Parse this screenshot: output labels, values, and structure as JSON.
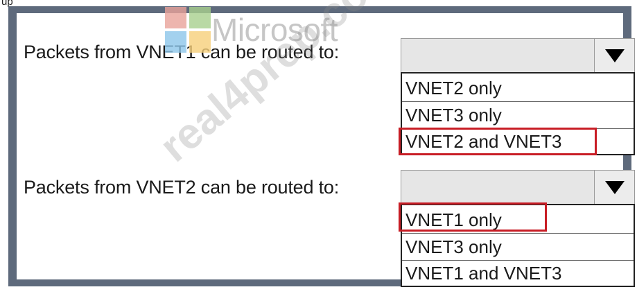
{
  "header": {
    "fragment": "up"
  },
  "questions": [
    {
      "label": "Packets from VNET1 can be routed to:",
      "selected_value": "",
      "options": [
        "VNET2 only",
        "VNET3 only",
        "VNET2 and VNET3"
      ],
      "highlighted_option": "VNET2 and VNET3"
    },
    {
      "label": "Packets from VNET2 can be routed to:",
      "selected_value": "",
      "options": [
        "VNET1 only",
        "VNET3 only",
        "VNET1 and VNET3"
      ],
      "highlighted_option": "VNET1 only"
    }
  ],
  "watermarks": {
    "brand": "Microsoft",
    "site": "real4prep.com"
  },
  "colors": {
    "highlight": "#c81d25",
    "frame": "#5e6a7c"
  },
  "icons": {
    "dropdown_arrow": "caret-down-icon",
    "logo": "microsoft-logo-icon"
  }
}
